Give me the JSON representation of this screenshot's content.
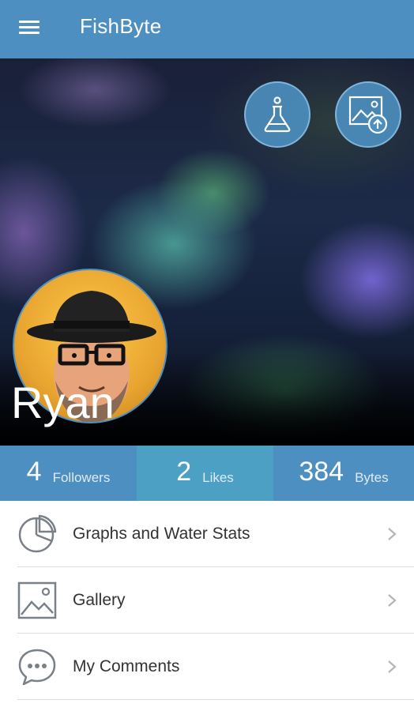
{
  "appbar": {
    "title": "FishByte"
  },
  "profile": {
    "name": "Ryan"
  },
  "stats": [
    {
      "value": "4",
      "label": "Followers"
    },
    {
      "value": "2",
      "label": "Likes"
    },
    {
      "value": "384",
      "label": "Bytes"
    }
  ],
  "menu": [
    {
      "label": "Graphs and Water Stats",
      "icon": "pie-chart-icon"
    },
    {
      "label": "Gallery",
      "icon": "image-icon"
    },
    {
      "label": "My Comments",
      "icon": "comment-icon"
    }
  ],
  "colors": {
    "appbar": "#4d8fc0",
    "stat_highlight": "#4ba0c4"
  }
}
